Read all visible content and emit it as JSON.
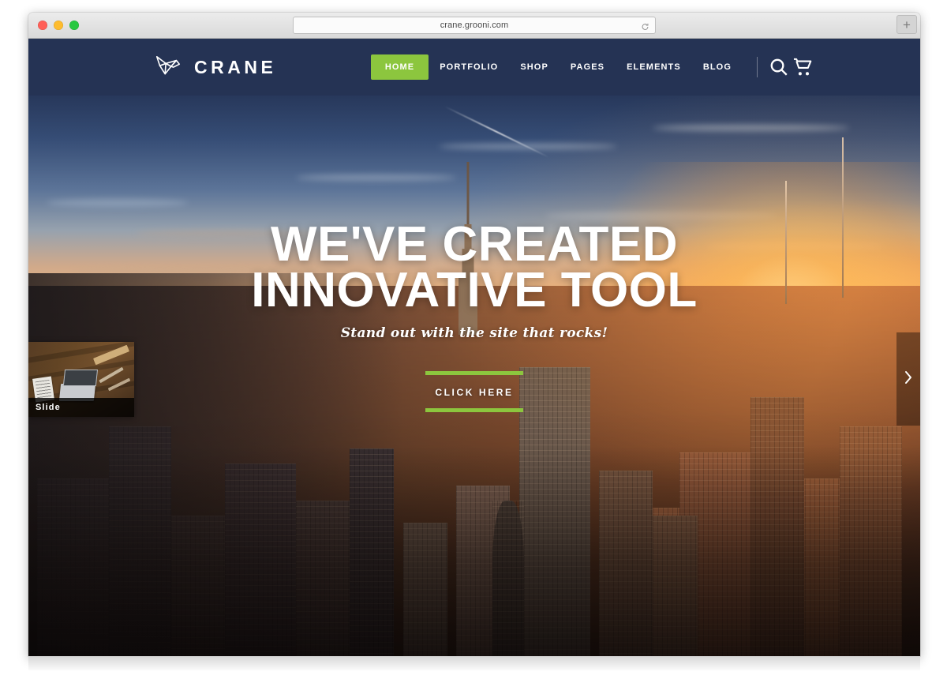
{
  "browser": {
    "url": "crane.grooni.com",
    "reload_icon": "reload-icon",
    "new_tab_label": "+",
    "traffic_lights": [
      "close",
      "minimize",
      "maximize"
    ]
  },
  "site": {
    "brand": {
      "name": "CRANE",
      "logo_icon": "origami-crane-logo"
    },
    "nav": {
      "items": [
        {
          "label": "HOME",
          "active": true
        },
        {
          "label": "PORTFOLIO",
          "active": false
        },
        {
          "label": "SHOP",
          "active": false
        },
        {
          "label": "PAGES",
          "active": false
        },
        {
          "label": "ELEMENTS",
          "active": false
        },
        {
          "label": "BLOG",
          "active": false
        }
      ],
      "search_icon": "search-icon",
      "cart_icon": "shopping-cart-icon",
      "active_color": "#8cc63e",
      "bar_color": "#253354"
    },
    "hero": {
      "title_line1": "WE'VE CREATED",
      "title_line2": "INNOVATIVE TOOL",
      "subtitle": "Stand out with the site that rocks!",
      "cta_label": "CLICK HERE",
      "accent_color": "#8cc63e"
    },
    "slider": {
      "thumbnail_label": "Slide",
      "next_arrow_icon": "chevron-right-icon"
    }
  }
}
